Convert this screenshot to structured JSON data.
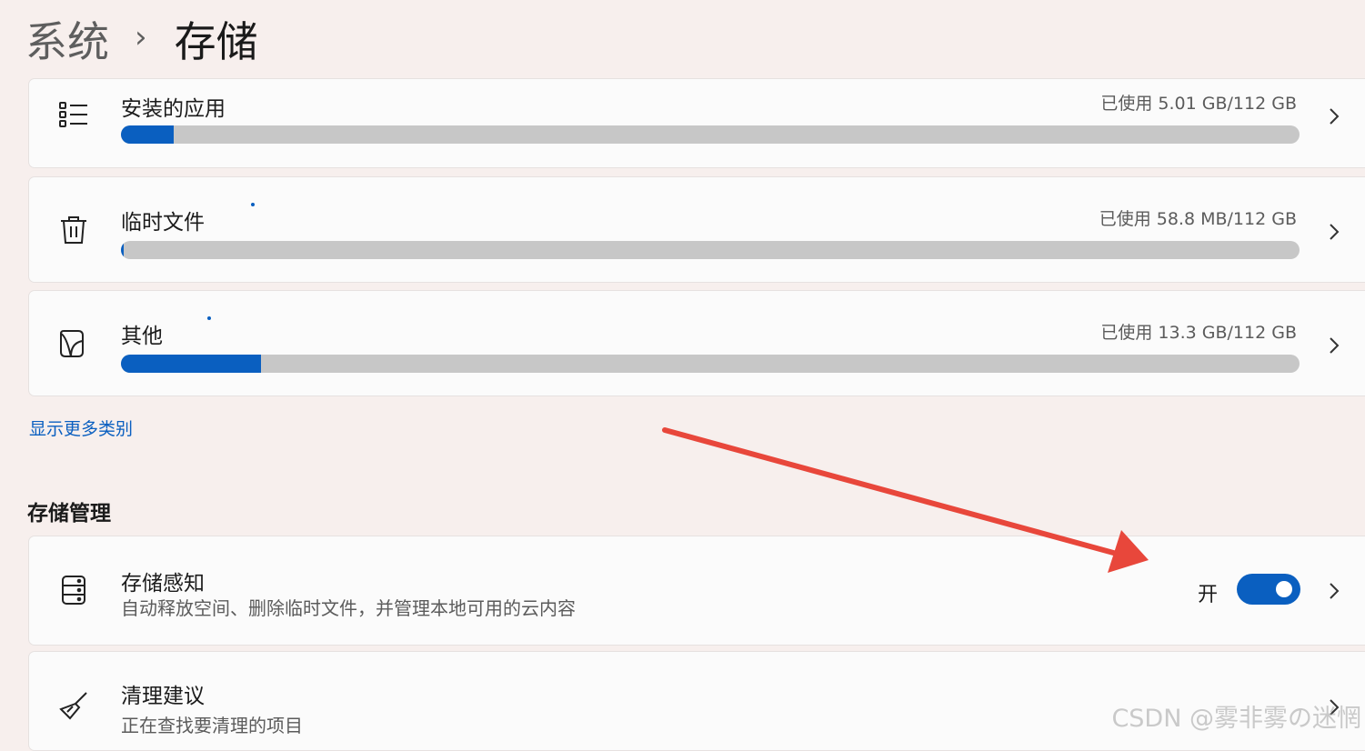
{
  "header": {
    "parent": "系统",
    "separator": "›",
    "current": "存储"
  },
  "categories": [
    {
      "label": "安装的应用",
      "usage": "已使用 5.01 GB/112 GB",
      "fraction": 0.0447,
      "icon": "list-icon"
    },
    {
      "label": "临时文件",
      "usage": "已使用 58.8 MB/112 GB",
      "fraction": 0.0005,
      "icon": "trash-icon"
    },
    {
      "label": "其他",
      "usage": "已使用 13.3 GB/112 GB",
      "fraction": 0.1188,
      "icon": "document-icon"
    }
  ],
  "show_more_link": "显示更多类别",
  "management": {
    "title": "存储管理",
    "storage_sense": {
      "title": "存储感知",
      "subtitle": "自动释放空间、删除临时文件，并管理本地可用的云内容",
      "toggle_label": "开",
      "toggle_on": true,
      "icon": "storage-drive-icon"
    },
    "cleanup": {
      "title": "清理建议",
      "subtitle": "正在查找要清理的项目",
      "icon": "broom-icon"
    }
  },
  "watermark": "CSDN @雾非雾の迷惘",
  "colors": {
    "accent": "#0a5fc0",
    "track": "#c7c7c7",
    "background": "#f7efed",
    "card": "#fbfbfb",
    "annotation_arrow": "#e8473b"
  }
}
